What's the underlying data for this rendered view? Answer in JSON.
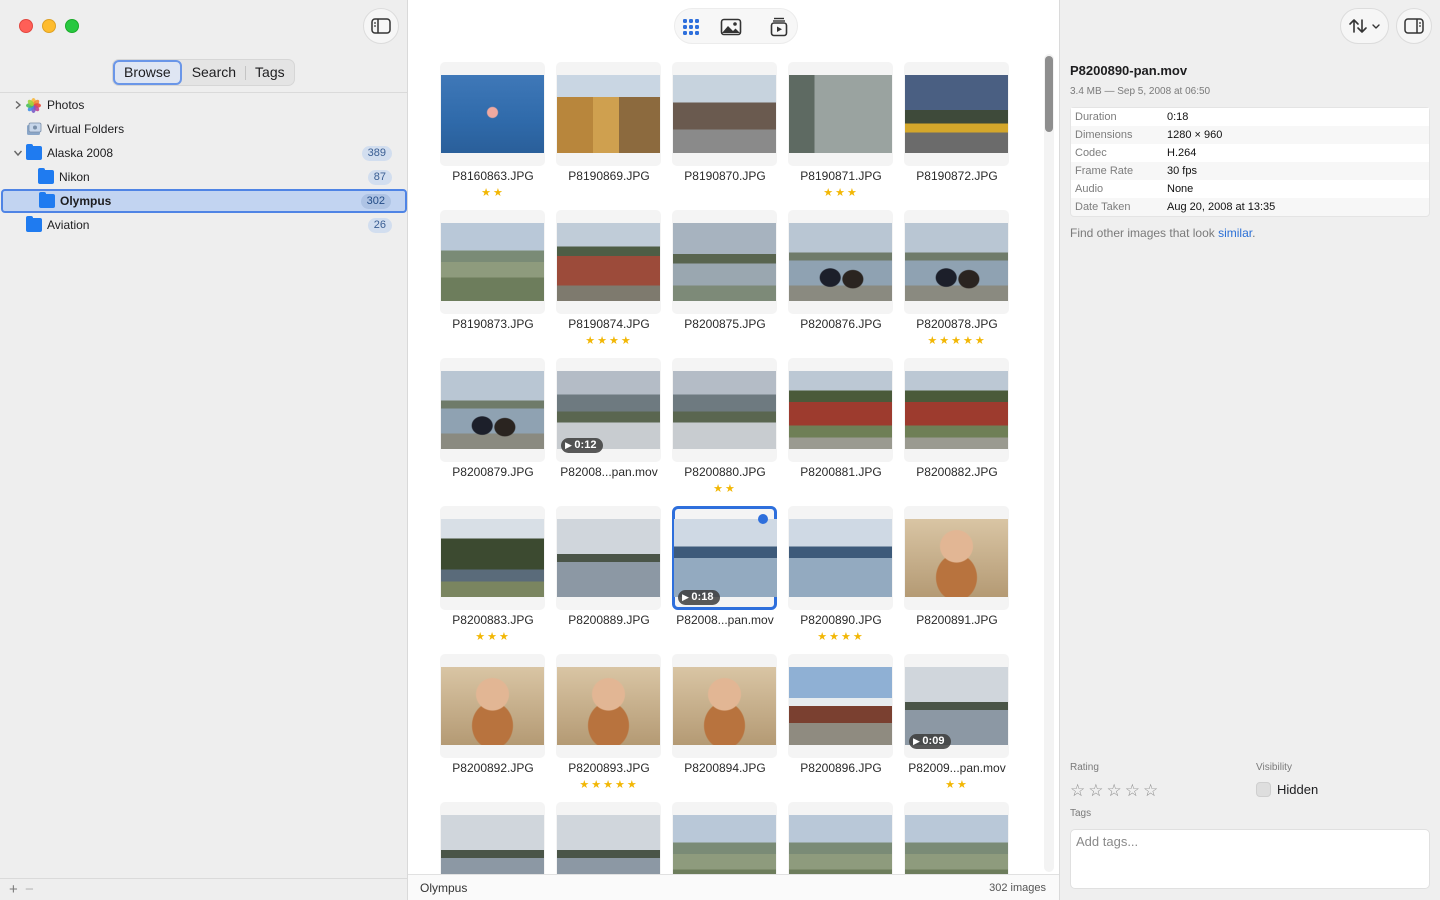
{
  "sidebar": {
    "tabs": [
      {
        "label": "Browse",
        "active": true
      },
      {
        "label": "Search",
        "active": false
      },
      {
        "label": "Tags",
        "active": false
      }
    ],
    "tree": [
      {
        "label": "Photos",
        "icon": "photos-icon",
        "expandable": true,
        "expanded": false,
        "level": 0,
        "count": null
      },
      {
        "label": "Virtual Folders",
        "icon": "virtual-folders-icon",
        "expandable": false,
        "expanded": false,
        "level": 0,
        "count": null
      },
      {
        "label": "Alaska 2008",
        "icon": "folder-icon",
        "expandable": true,
        "expanded": true,
        "level": 0,
        "count": "389"
      },
      {
        "label": "Nikon",
        "icon": "folder-icon",
        "expandable": false,
        "expanded": false,
        "level": 1,
        "count": "87"
      },
      {
        "label": "Olympus",
        "icon": "folder-icon",
        "expandable": false,
        "expanded": false,
        "level": 1,
        "count": "302",
        "selected": true
      },
      {
        "label": "Aviation",
        "icon": "folder-icon",
        "expandable": false,
        "expanded": false,
        "level": 0,
        "count": "26"
      }
    ],
    "bottom": {
      "add": "+",
      "remove": "−"
    }
  },
  "toolbar": {
    "view_buttons": [
      "grid-view-icon",
      "single-image-icon",
      "slideshow-icon"
    ],
    "active_view": "grid-view-icon"
  },
  "grid": {
    "items": [
      {
        "name": "P8160863.JPG",
        "stars": 2,
        "scene": "moon"
      },
      {
        "name": "P8190869.JPG",
        "stars": 0,
        "scene": "street"
      },
      {
        "name": "P8190870.JPG",
        "stars": 0,
        "scene": "town"
      },
      {
        "name": "P8190871.JPG",
        "stars": 3,
        "scene": "building"
      },
      {
        "name": "P8190872.JPG",
        "stars": 0,
        "scene": "tram"
      },
      {
        "name": "P8190873.JPG",
        "stars": 0,
        "scene": "valley"
      },
      {
        "name": "P8190874.JPG",
        "stars": 4,
        "scene": "cabin"
      },
      {
        "name": "P8200875.JPG",
        "stars": 0,
        "scene": "river"
      },
      {
        "name": "P8200876.JPG",
        "stars": 0,
        "scene": "people-lake"
      },
      {
        "name": "P8200878.JPG",
        "stars": 5,
        "scene": "people-lake"
      },
      {
        "name": "P8200879.JPG",
        "stars": 0,
        "scene": "people-lake"
      },
      {
        "name": "P82008...pan.mov",
        "stars": 0,
        "scene": "mountain",
        "duration": "0:12"
      },
      {
        "name": "P8200880.JPG",
        "stars": 2,
        "scene": "mountain"
      },
      {
        "name": "P8200881.JPG",
        "stars": 0,
        "scene": "sign"
      },
      {
        "name": "P8200882.JPG",
        "stars": 0,
        "scene": "sign"
      },
      {
        "name": "P8200883.JPG",
        "stars": 3,
        "scene": "forest"
      },
      {
        "name": "P8200889.JPG",
        "stars": 0,
        "scene": "lake-cloudy"
      },
      {
        "name": "P82008...pan.mov",
        "stars": 0,
        "scene": "lake-blue",
        "duration": "0:18",
        "selected": true
      },
      {
        "name": "P8200890.JPG",
        "stars": 4,
        "scene": "lake-blue"
      },
      {
        "name": "P8200891.JPG",
        "stars": 0,
        "scene": "food"
      },
      {
        "name": "P8200892.JPG",
        "stars": 0,
        "scene": "food"
      },
      {
        "name": "P8200893.JPG",
        "stars": 5,
        "scene": "food"
      },
      {
        "name": "P8200894.JPG",
        "stars": 0,
        "scene": "food"
      },
      {
        "name": "P8200896.JPG",
        "stars": 0,
        "scene": "lodge"
      },
      {
        "name": "P82009...pan.mov",
        "stars": 2,
        "scene": "lake-cloudy",
        "duration": "0:09"
      },
      {
        "name": "",
        "stars": 0,
        "scene": "lake-cloudy"
      },
      {
        "name": "",
        "stars": 0,
        "scene": "lake-cloudy"
      },
      {
        "name": "",
        "stars": 0,
        "scene": "valley"
      },
      {
        "name": "",
        "stars": 0,
        "scene": "valley"
      },
      {
        "name": "",
        "stars": 0,
        "scene": "valley"
      }
    ]
  },
  "status": {
    "folder": "Olympus",
    "count": "302 images"
  },
  "inspector": {
    "title": "P8200890-pan.mov",
    "subtitle": "3.4 MB — Sep 5, 2008 at 06:50",
    "metadata": [
      {
        "key": "Duration",
        "value": "0:18"
      },
      {
        "key": "Dimensions",
        "value": "1280 × 960"
      },
      {
        "key": "Codec",
        "value": "H.264"
      },
      {
        "key": "Frame Rate",
        "value": "30 fps"
      },
      {
        "key": "Audio",
        "value": "None"
      },
      {
        "key": "Date Taken",
        "value": "Aug 20, 2008 at 13:35"
      }
    ],
    "similar_prefix": "Find other images that look ",
    "similar_link": "similar",
    "similar_suffix": ".",
    "rating_label": "Rating",
    "rating_value": 0,
    "visibility_label": "Visibility",
    "hidden_label": "Hidden",
    "tags_label": "Tags",
    "tags_placeholder": "Add tags..."
  }
}
